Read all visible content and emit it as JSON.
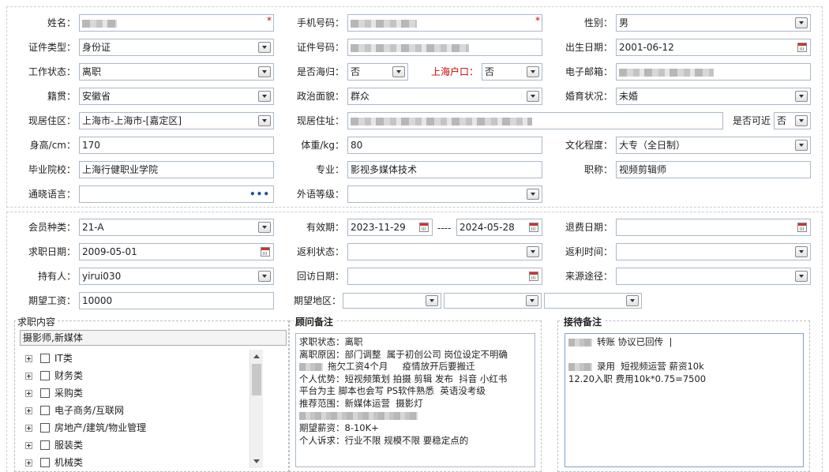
{
  "form": {
    "name": {
      "label": "姓名：",
      "required_mark": "*"
    },
    "phone": {
      "label": "手机号码：",
      "required_mark": "*"
    },
    "gender": {
      "label": "性别：",
      "value": "男"
    },
    "id_type": {
      "label": "证件类型：",
      "value": "身份证"
    },
    "id_number": {
      "label": "证件号码："
    },
    "birth_date": {
      "label": "出生日期：",
      "value": "2001-06-12"
    },
    "work_status": {
      "label": "工作状态：",
      "value": "离职"
    },
    "returnee": {
      "label": "是否海归：",
      "value": "否"
    },
    "shanghai_hukou": {
      "label": "上海户口：",
      "value": "否"
    },
    "email": {
      "label": "电子邮箱："
    },
    "native_place": {
      "label": "籍贯：",
      "value": "安徽省"
    },
    "political_status": {
      "label": "政治面貌：",
      "value": "群众"
    },
    "marital_status": {
      "label": "婚育状况：",
      "value": "未婚"
    },
    "current_area": {
      "label": "现居住区：",
      "value": "上海市-上海市-[嘉定区]"
    },
    "current_address": {
      "label": "现居住址："
    },
    "reachable": {
      "label": "是否可近",
      "value": "否"
    },
    "height": {
      "label": "身高/cm：",
      "value": "170"
    },
    "weight": {
      "label": "体重/kg：",
      "value": "80"
    },
    "education": {
      "label": "文化程度：",
      "value": "大专（全日制）"
    },
    "school": {
      "label": "毕业院校：",
      "value": "上海行健职业学院"
    },
    "major": {
      "label": "专业：",
      "value": "影视多媒体技术"
    },
    "job_title": {
      "label": "职称：",
      "value": "视频剪辑师"
    },
    "languages": {
      "label": "通晓语言："
    },
    "foreign_level": {
      "label": "外语等级："
    }
  },
  "membership": {
    "member_type": {
      "label": "会员种类：",
      "value": "21-A"
    },
    "validity": {
      "label": "有效期：",
      "start": "2023-11-29",
      "separator": "----",
      "end": "2024-05-28"
    },
    "refund_date": {
      "label": "退费日期："
    },
    "job_seek_date": {
      "label": "求职日期：",
      "value": "2009-05-01"
    },
    "rebate_status": {
      "label": "返利状态："
    },
    "rebate_time": {
      "label": "返利时间："
    },
    "holder": {
      "label": "持有人：",
      "value": "yirui030"
    },
    "visit_date": {
      "label": "回访日期："
    },
    "source": {
      "label": "来源途径："
    },
    "expected_salary": {
      "label": "期望工资：",
      "value": "10000"
    },
    "expected_area": {
      "label": "期望地区："
    }
  },
  "job_content": {
    "title": "求职内容",
    "selected": "摄影师,新媒体",
    "categories": [
      "IT类",
      "财务类",
      "采购类",
      "电子商务/互联网",
      "房地产/建筑/物业管理",
      "服装类",
      "机械类"
    ]
  },
  "advisor_notes": {
    "title": "顾问备注",
    "lines": [
      {
        "text": "求职状态：离职"
      },
      {
        "text": "离职原因：部门调整  属于初创公司 岗位设定不明确"
      },
      {
        "text": "拖欠工资4个月     疫情放开后要搬迁",
        "blur_prefix": true
      },
      {
        "text": "个人优势：短视频策划 拍摄 剪辑 发布  抖音 小红书"
      },
      {
        "text": "平台为主 脚本也会写 PS软件熟悉  英语没考级"
      },
      {
        "text": "推荐范围：新媒体运营  摄影灯"
      },
      {
        "text": "",
        "blur_only": true
      },
      {
        "text": "期望薪资：8-10K+"
      },
      {
        "text": "个人诉求：行业不限 规模不限 要稳定点的"
      }
    ]
  },
  "reception_notes": {
    "title": "接待备注",
    "lines": [
      {
        "text": "转账 协议已回传  |",
        "blur_prefix": true
      },
      {
        "text": ""
      },
      {
        "text": "录用  短视频运营 薪资10k",
        "blur_prefix": true
      },
      {
        "text": "12.20入职 费用10k*0.75=7500"
      }
    ]
  }
}
